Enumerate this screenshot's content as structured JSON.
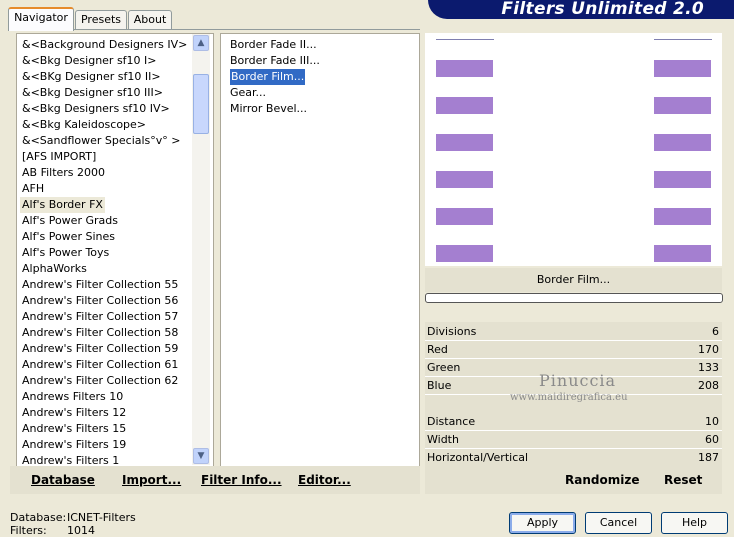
{
  "window": {
    "title": "Filters Unlimited 2.0"
  },
  "tabs": [
    {
      "label": "Navigator"
    },
    {
      "label": "Presets"
    },
    {
      "label": "About"
    }
  ],
  "categories": {
    "items": [
      "&<Background Designers IV>",
      "&<Bkg Designer sf10 I>",
      "&<BKg Designer sf10 II>",
      "&<Bkg Designer sf10 III>",
      "&<Bkg Designers sf10 IV>",
      "&<Bkg Kaleidoscope>",
      "&<Sandflower Specials°v° >",
      "[AFS IMPORT]",
      "AB Filters 2000",
      "AFH",
      "Alf's Border FX",
      "Alf's Power Grads",
      "Alf's Power Sines",
      "Alf's Power Toys",
      "AlphaWorks",
      "Andrew's Filter Collection 55",
      "Andrew's Filter Collection 56",
      "Andrew's Filter Collection 57",
      "Andrew's Filter Collection 58",
      "Andrew's Filter Collection 59",
      "Andrew's Filter Collection 61",
      "Andrew's Filter Collection 62",
      "Andrews Filters 10",
      "Andrew's Filters 12",
      "Andrew's Filters 15",
      "Andrew's Filters 19",
      "Andrew's Filters 1"
    ],
    "highlighted": "Alf's Border FX"
  },
  "filters": {
    "items": [
      "Border Fade II...",
      "Border Fade III...",
      "Border Film...",
      "Gear...",
      "Mirror Bevel..."
    ],
    "selected": "Border Film..."
  },
  "toolbar": {
    "database": "Database",
    "import": "Import...",
    "filter_info": "Filter Info...",
    "editor": "Editor..."
  },
  "preview": {
    "filter_name": "Border Film...",
    "bar_color": "#a47fd0"
  },
  "params": {
    "group1": [
      {
        "label": "Divisions",
        "value": "6"
      },
      {
        "label": "Red",
        "value": "170"
      },
      {
        "label": "Green",
        "value": "133"
      },
      {
        "label": "Blue",
        "value": "208"
      }
    ],
    "group2": [
      {
        "label": "Distance",
        "value": "10"
      },
      {
        "label": "Width",
        "value": "60"
      },
      {
        "label": "Horizontal/Vertical",
        "value": "187"
      }
    ]
  },
  "actions": {
    "randomize": "Randomize",
    "reset": "Reset"
  },
  "status": {
    "database_label": "Database:",
    "database_value": "ICNET-Filters",
    "filters_label": "Filters:",
    "filters_value": "1014"
  },
  "dialog_buttons": {
    "apply": "Apply",
    "cancel": "Cancel",
    "help": "Help"
  },
  "watermark": {
    "name": "Pinuccia",
    "url": "www.maidiregrafica.eu"
  }
}
